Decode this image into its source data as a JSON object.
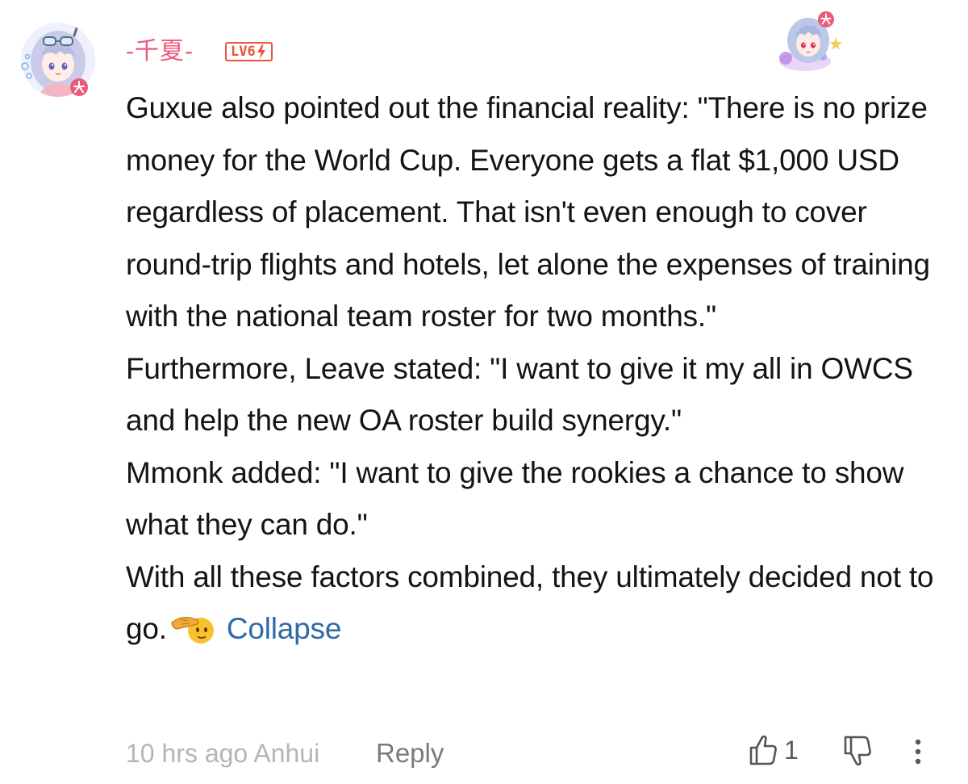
{
  "comment": {
    "author": {
      "name": "-千夏-",
      "level": "LV6",
      "avatar_icon": "anime-girl-avatar-icon",
      "pendant_icon": "anime-character-pendant-icon",
      "name_color": "#ec5a7a"
    },
    "paragraphs": [
      "Guxue also pointed out the financial reality: \"There is no prize money for the World Cup. Everyone gets a flat $1,000 USD regardless of placement. That isn't even enough to cover round-trip flights and hotels, let alone the expenses of training with the national team roster for two months.\"",
      "Furthermore, Leave stated: \"I want to give it my all in OWCS and help the new OA roster build synergy.\"",
      "Mmonk added: \"I want to give the rookies a chance to show what they can do.\"",
      "With all these factors combined, they ultimately decided not to go."
    ],
    "trailing_emoji": "saluting-face-emoji",
    "collapse_label": "Collapse",
    "link_color": "#2f6aa8",
    "footer": {
      "time_location": "10 hrs ago Anhui",
      "reply_label": "Reply",
      "like_count": "1",
      "like_icon": "thumbs-up-icon",
      "dislike_icon": "thumbs-down-icon",
      "more_icon": "more-vertical-icon"
    }
  }
}
